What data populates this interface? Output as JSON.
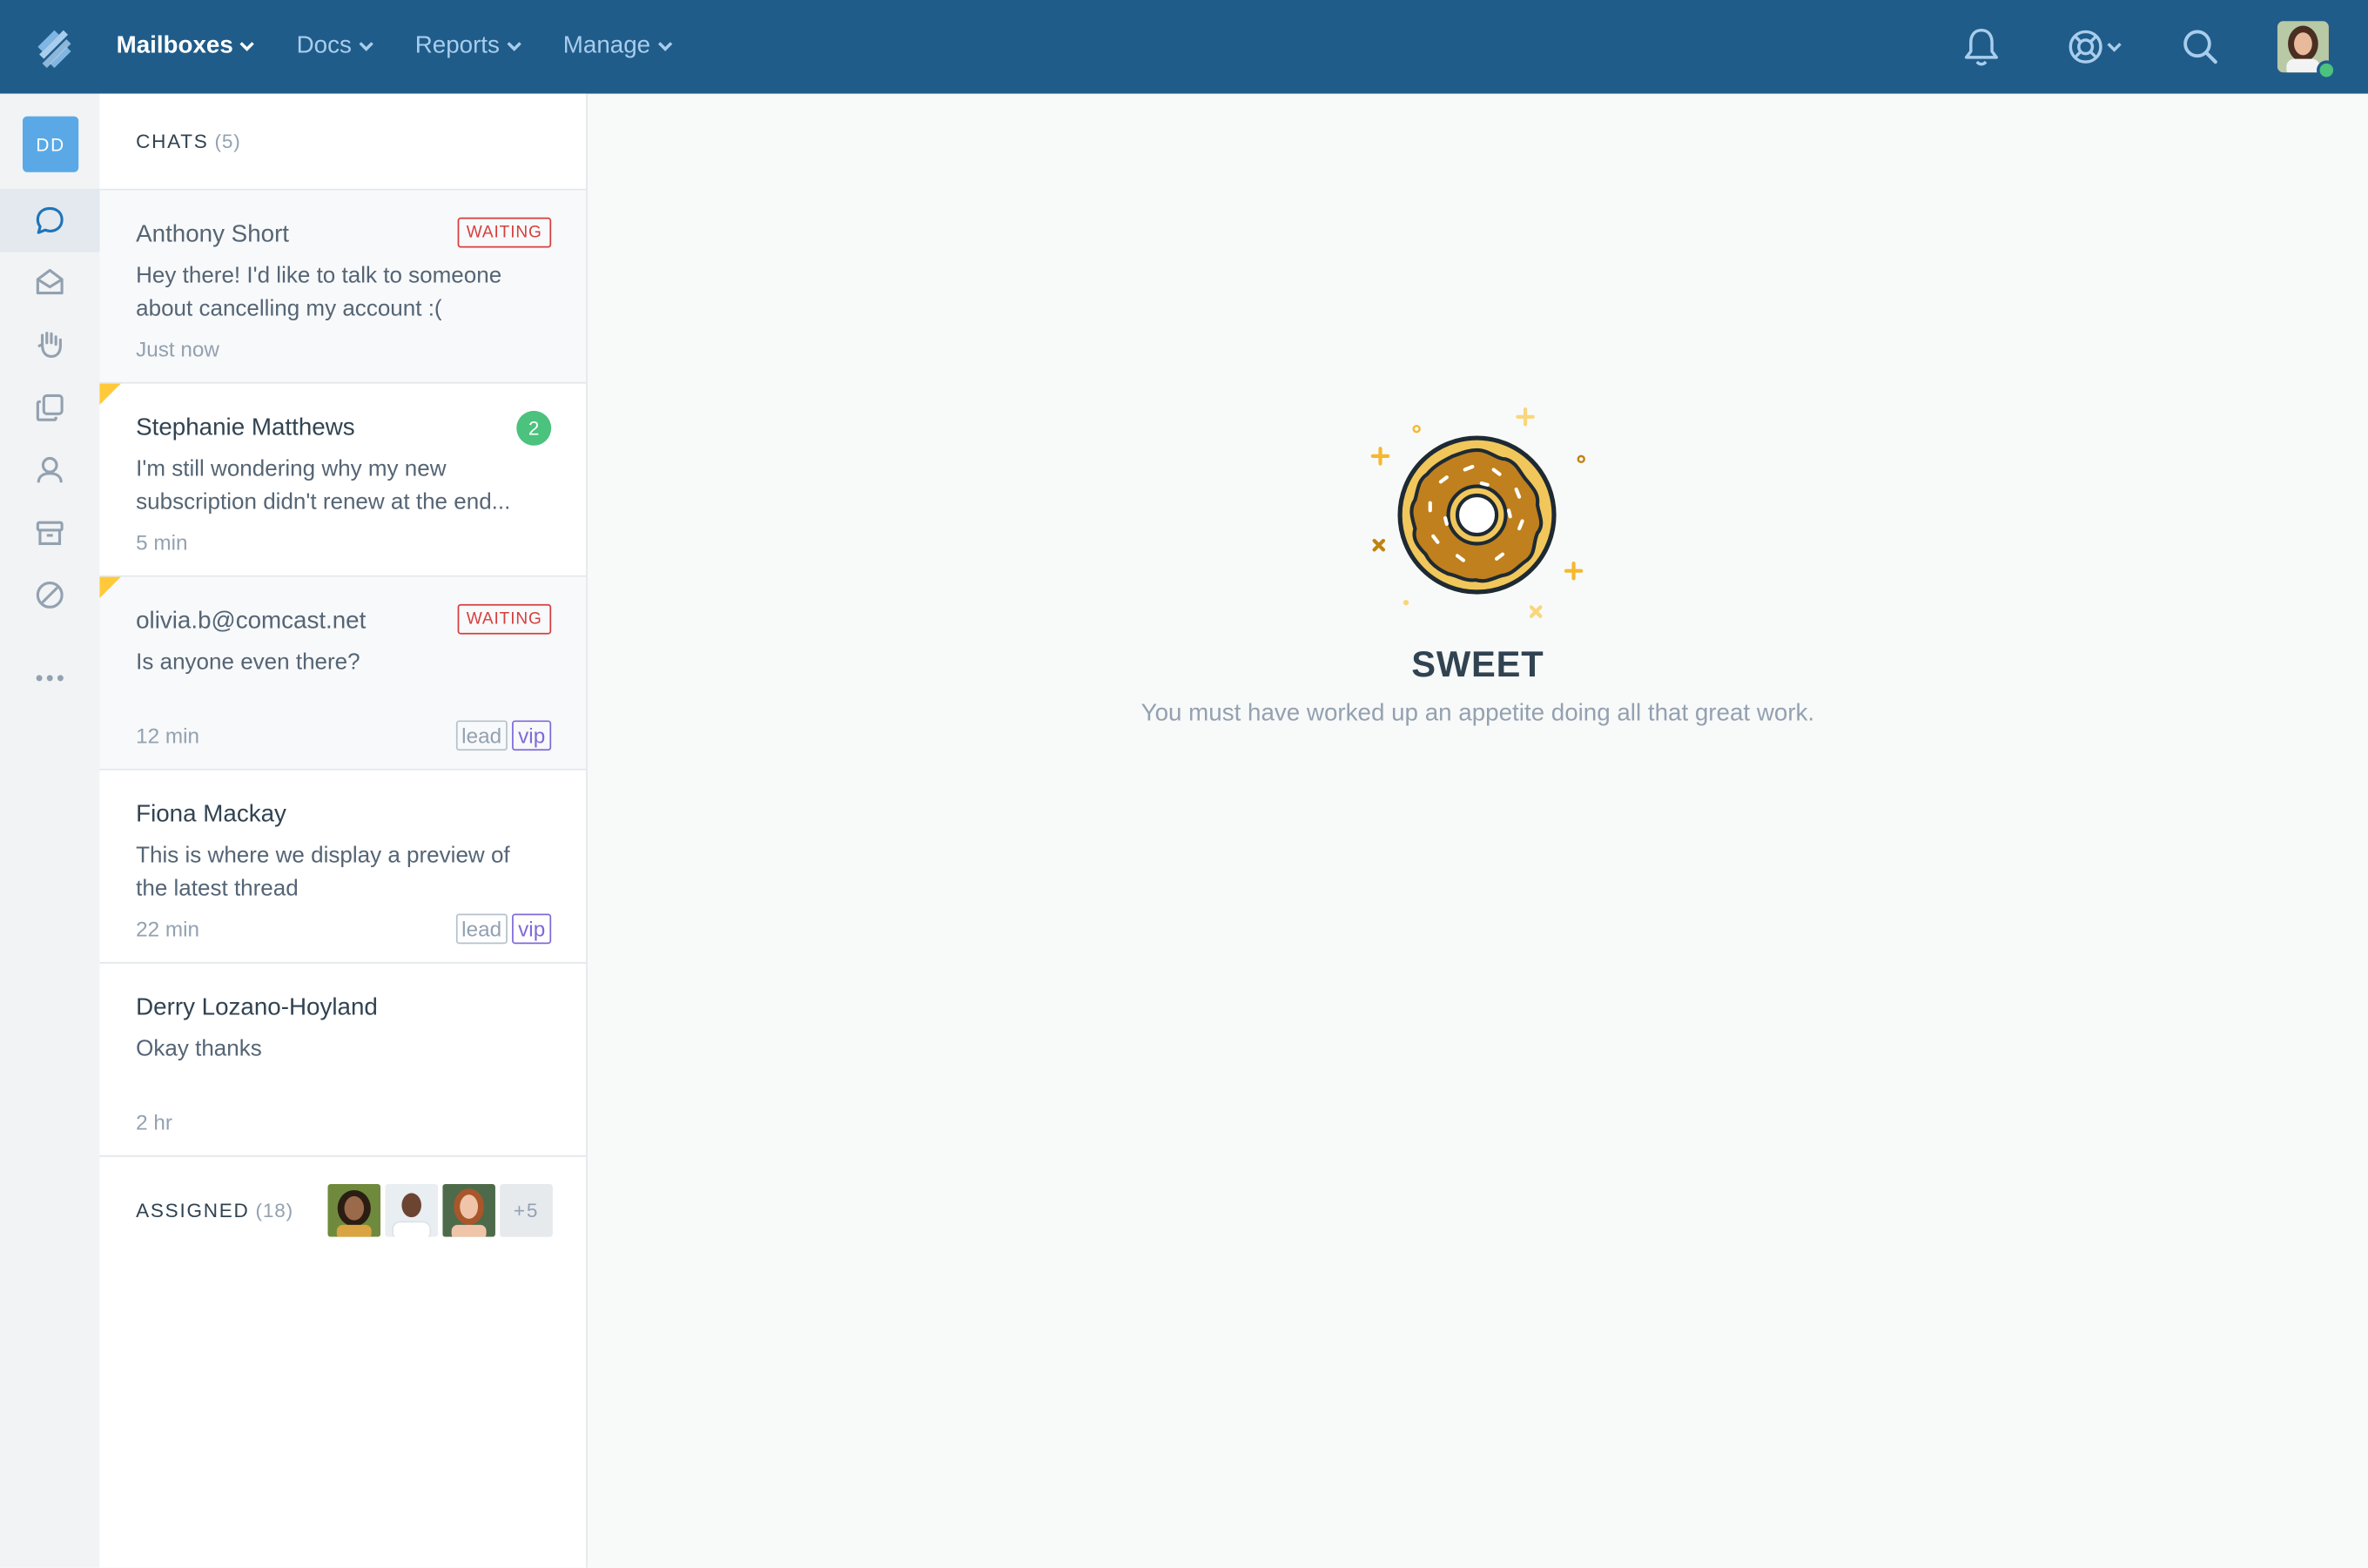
{
  "nav": {
    "items": [
      {
        "label": "Mailboxes",
        "active": true
      },
      {
        "label": "Docs",
        "active": false
      },
      {
        "label": "Reports",
        "active": false
      },
      {
        "label": "Manage",
        "active": false
      }
    ],
    "right_icons": [
      "bell-icon",
      "help-lifebuoy-icon",
      "search-icon",
      "user-avatar"
    ],
    "status_color": "#4bc27d"
  },
  "rail": {
    "badge": "DD",
    "items": [
      "chat-icon",
      "inbox-icon",
      "hand-icon",
      "docs-icon",
      "customer-icon",
      "archive-icon",
      "spam-icon",
      "more-icon"
    ]
  },
  "list": {
    "title": "CHATS",
    "count": "(5)",
    "conversations": [
      {
        "name": "Anthony Short",
        "preview": "Hey there! I'd like to talk to someone about cancelling my account :(",
        "time": "Just now",
        "status": "WAITING"
      },
      {
        "name": "Stephanie Matthews",
        "preview": "I'm still wondering why my new subscription didn't renew at the end...",
        "time": "5 min",
        "unread": "2"
      },
      {
        "name": "olivia.b@comcast.net",
        "preview": "Is anyone even there?",
        "time": "12 min",
        "status": "WAITING",
        "tags": [
          "lead",
          "vip"
        ]
      },
      {
        "name": "Fiona Mackay",
        "preview": "This is where we display a preview of the latest thread",
        "time": "22 min",
        "tags": [
          "lead",
          "vip"
        ]
      },
      {
        "name": "Derry Lozano-Hoyland",
        "preview": "Okay thanks",
        "time": "2 hr"
      }
    ],
    "assigned": {
      "title": "ASSIGNED",
      "count": "(18)",
      "more": "+5"
    }
  },
  "empty_state": {
    "title": "SWEET",
    "subtitle": "You must have worked up an appetite doing all that great work."
  },
  "colors": {
    "topbar": "#1f5c8a",
    "waiting": "#d63e3e",
    "unread": "#4bc27d",
    "vip": "#7f6ad7",
    "flag": "#ffc93a"
  }
}
